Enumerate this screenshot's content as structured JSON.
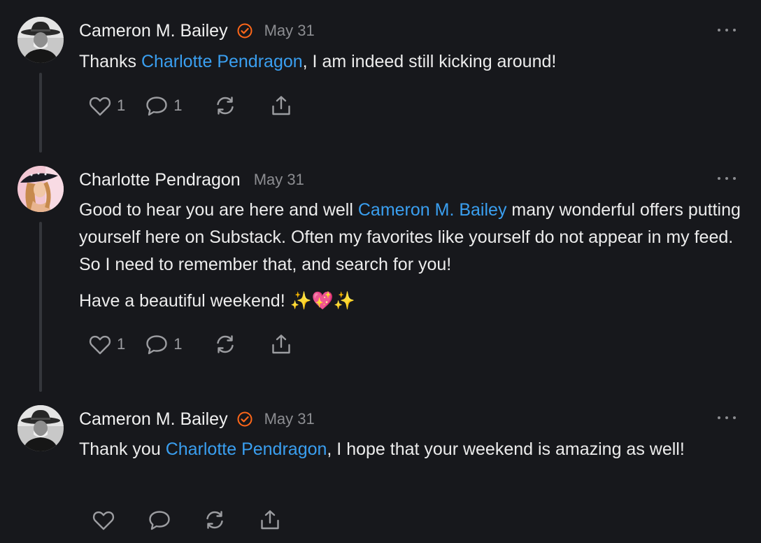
{
  "comments": [
    {
      "author": "Cameron M. Bailey",
      "verified": true,
      "date": "May 31",
      "paragraphs": [
        [
          {
            "text": "Thanks "
          },
          {
            "text": "Charlotte Pendragon",
            "mention": true
          },
          {
            "text": ", I am indeed still kicking around!"
          }
        ]
      ],
      "likes": "1",
      "replies": "1"
    },
    {
      "author": "Charlotte Pendragon",
      "verified": false,
      "date": "May 31",
      "paragraphs": [
        [
          {
            "text": "Good to hear you are here and well "
          },
          {
            "text": "Cameron M. Bailey",
            "mention": true
          },
          {
            "text": " many wonderful offers putting yourself here on Substack. Often my favorites like yourself do not appear in my feed. So I need to remember that, and search for you!"
          }
        ],
        [
          {
            "text": "Have a beautiful weekend! ✨💖✨"
          }
        ]
      ],
      "likes": "1",
      "replies": "1"
    },
    {
      "author": "Cameron M. Bailey",
      "verified": true,
      "date": "May 31",
      "paragraphs": [
        [
          {
            "text": "Thank you "
          },
          {
            "text": "Charlotte Pendragon",
            "mention": true
          },
          {
            "text": ", I hope that your weekend is amazing as well!"
          }
        ]
      ],
      "likes": "",
      "replies": ""
    }
  ],
  "icons": {
    "like": "heart-icon",
    "reply": "comment-bubble-icon",
    "restack": "restack-icon",
    "share": "share-icon",
    "more": "more-horizontal-icon",
    "verified": "verified-badge-icon"
  },
  "colors": {
    "background": "#17181c",
    "mention": "#3a9ff0",
    "verified": "#ff6719",
    "muted": "#8c8d91"
  }
}
